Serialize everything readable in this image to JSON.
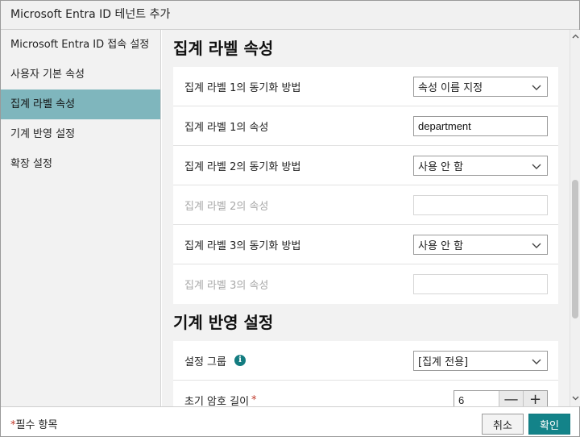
{
  "window": {
    "title": "Microsoft Entra ID 테넌트 추가"
  },
  "sidebar": {
    "items": [
      {
        "label": "Microsoft Entra ID 접속 설정",
        "active": false
      },
      {
        "label": "사용자 기본 속성",
        "active": false
      },
      {
        "label": "집계 라벨 속성",
        "active": true
      },
      {
        "label": "기계 반영 설정",
        "active": false
      },
      {
        "label": "확장 설정",
        "active": false
      }
    ]
  },
  "sections": {
    "aggregate_labels": {
      "title": "집계 라벨 속성",
      "rows": [
        {
          "label": "집계 라벨 1의 동기화 방법",
          "type": "select",
          "value": "속성 이름 지정"
        },
        {
          "label": "집계 라벨 1의 속성",
          "type": "text",
          "value": "department"
        },
        {
          "label": "집계 라벨 2의 동기화 방법",
          "type": "select",
          "value": "사용 안 함"
        },
        {
          "label": "집계 라벨 2의 속성",
          "type": "text",
          "value": "",
          "disabled": true
        },
        {
          "label": "집계 라벨 3의 동기화 방법",
          "type": "select",
          "value": "사용 안 함"
        },
        {
          "label": "집계 라벨 3의 속성",
          "type": "text",
          "value": "",
          "disabled": true
        }
      ]
    },
    "machine_settings": {
      "title": "기계 반영 설정",
      "group_label": "설정 그룹",
      "group_value": "[집계 전용]",
      "info_icon": "info-icon",
      "password_label": "초기 암호 길이",
      "password_required_mark": "*",
      "password_value": "6",
      "minus": "—",
      "plus": "+"
    }
  },
  "footer": {
    "required_star": "*",
    "required_note": "필수 항목",
    "cancel_label": "취소",
    "ok_label": "확인"
  },
  "colors": {
    "accent": "#138389",
    "sidebar_active": "#7fb6bd",
    "required": "#c0392b"
  }
}
